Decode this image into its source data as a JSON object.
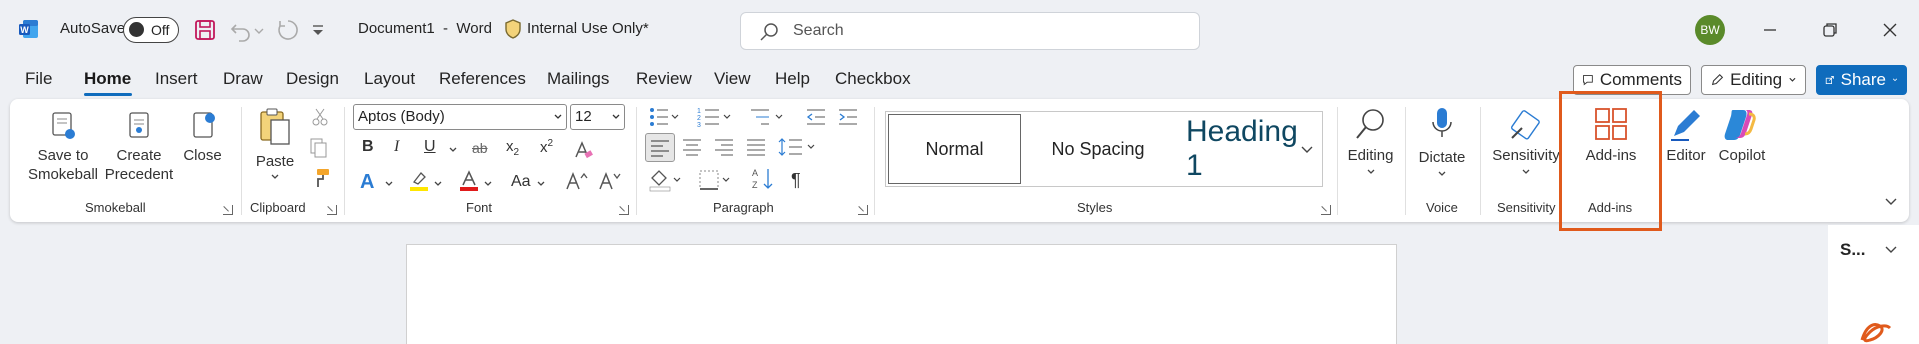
{
  "titlebar": {
    "autosave_label": "AutoSave",
    "autosave_state": "Off",
    "doc_title": "Document1  -  Word",
    "sensitivity_label": "Internal Use Only*",
    "search_placeholder": "Search",
    "avatar_initials": "BW"
  },
  "tabs": [
    "File",
    "Home",
    "Insert",
    "Draw",
    "Design",
    "Layout",
    "References",
    "Mailings",
    "Review",
    "View",
    "Help",
    "Checkbox"
  ],
  "active_tab": "Home",
  "actions": {
    "comments": "Comments",
    "editing": "Editing",
    "share": "Share"
  },
  "ribbon": {
    "smokeball": {
      "label": "Smokeball",
      "save_to": "Save to Smokeball",
      "create_precedent": "Create Precedent",
      "close": "Close"
    },
    "clipboard": {
      "label": "Clipboard",
      "paste": "Paste"
    },
    "font": {
      "label": "Font",
      "font_name": "Aptos (Body)",
      "font_size": "12",
      "change_case": "Aa"
    },
    "paragraph": {
      "label": "Paragraph"
    },
    "styles": {
      "label": "Styles",
      "items": [
        "Normal",
        "No Spacing",
        "Heading 1"
      ]
    },
    "editing": {
      "label": "Editing"
    },
    "voice": {
      "label": "Voice",
      "dictate": "Dictate"
    },
    "sensitivity": {
      "label": "Sensitivity",
      "button": "Sensitivity"
    },
    "addins": {
      "label": "Add-ins",
      "button": "Add-ins"
    },
    "editor": "Editor",
    "copilot": "Copilot"
  },
  "side_pane": {
    "title": "S..."
  },
  "colors": {
    "accent": "#0f6cbd",
    "highlight_box": "#e05a1c",
    "avatar_bg": "#5a8a2a"
  }
}
